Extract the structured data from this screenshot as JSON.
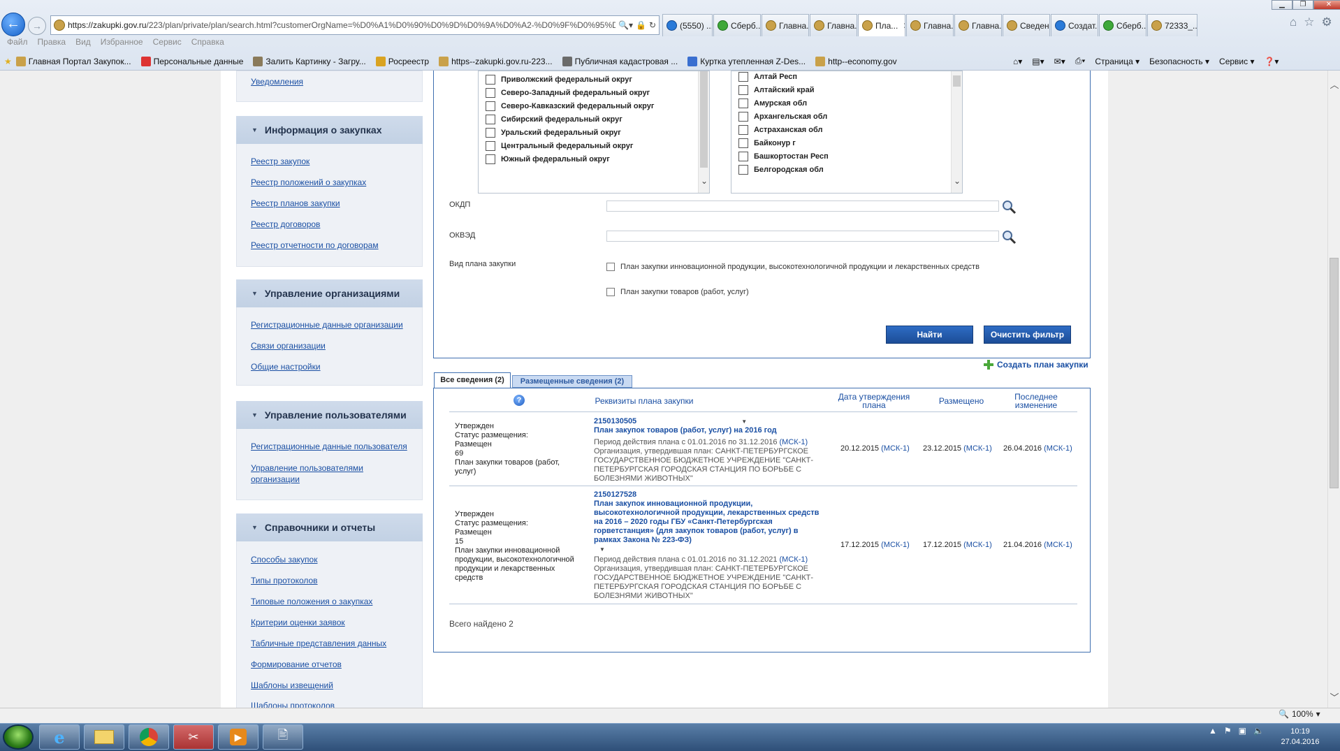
{
  "browser": {
    "url_host": "https://zakupki.gov.ru",
    "url_path": "/223/plan/private/plan/search.html?customerOrgName=%D0%A1%D0%90%D0%9D%D0%9A%D0%A2-%D0%9F%D0%95%D0",
    "tabs": [
      {
        "label": "(5550) ...",
        "icon": "blue"
      },
      {
        "label": "Сберб...",
        "icon": "green"
      },
      {
        "label": "Главна...",
        "icon": "emblem"
      },
      {
        "label": "Главна...",
        "icon": "emblem"
      },
      {
        "label": "Пла...",
        "icon": "emblem",
        "active": true
      },
      {
        "label": "Главна...",
        "icon": "emblem"
      },
      {
        "label": "Главна...",
        "icon": "emblem"
      },
      {
        "label": "Сведен...",
        "icon": "emblem"
      },
      {
        "label": "Создат...",
        "icon": "blue"
      },
      {
        "label": "Сберб...",
        "icon": "green"
      },
      {
        "label": "72333_...",
        "icon": "emblem"
      }
    ],
    "menu": [
      "Файл",
      "Правка",
      "Вид",
      "Избранное",
      "Сервис",
      "Справка"
    ],
    "favorites": [
      "Главная Портал Закупок...",
      "Персональные данные",
      "Залить Картинку - Загру...",
      "Росреестр",
      "https--zakupki.gov.ru-223...",
      "Публичная кадастровая ...",
      "Куртка утепленная Z-Des...",
      "http--economy.gov"
    ],
    "commands": [
      "Страница ▾",
      "Безопасность ▾",
      "Сервис ▾"
    ],
    "zoom": "100%"
  },
  "sidebar": {
    "top_link": "Уведомления",
    "sections": [
      {
        "title": "Информация о закупках",
        "links": [
          "Реестр закупок",
          "Реестр положений о закупках",
          "Реестр планов закупки",
          "Реестр договоров",
          "Реестр отчетности по договорам"
        ]
      },
      {
        "title": "Управление организациями",
        "links": [
          "Регистрационные данные организации",
          "Связи организации",
          "Общие настройки"
        ]
      },
      {
        "title": "Управление пользователями",
        "links": [
          "Регистрационные данные пользователя",
          "Управление пользователями организации"
        ]
      },
      {
        "title": "Справочники и отчеты",
        "links": [
          "Способы закупок",
          "Типы протоколов",
          "Типовые положения о закупках",
          "Критерии оценки заявок",
          "Табличные представления данных",
          "Формирование отчетов",
          "Шаблоны извещений",
          "Шаблоны протоколов"
        ]
      }
    ]
  },
  "filter": {
    "districts": [
      "Приволжский федеральный округ",
      "Северо-Западный федеральный округ",
      "Северо-Кавказский федеральный округ",
      "Сибирский федеральный округ",
      "Уральский федеральный округ",
      "Центральный федеральный округ",
      "Южный федеральный округ"
    ],
    "regions": [
      "Алтай Респ",
      "Алтайский край",
      "Амурская обл",
      "Архангельская обл",
      "Астраханская обл",
      "Байконур г",
      "Башкортостан Респ",
      "Белгородская обл"
    ],
    "okdp_label": "ОКДП",
    "okved_label": "ОКВЭД",
    "plan_type_label": "Вид плана закупки",
    "plan_type_options": [
      "План закупки инновационной продукции, высокотехнологичной продукции и лекарственных средств",
      "План закупки товаров (работ, услуг)"
    ],
    "search_button": "Найти",
    "clear_button": "Очистить фильтр"
  },
  "results": {
    "tab_all": "Все сведения (2)",
    "tab_placed": "Размещенные сведения (2)",
    "create_plan": "Создать план закупки",
    "help_icon": "?",
    "columns": {
      "details": "Реквизиты плана закупки",
      "approval_date_1": "Дата утверждения",
      "approval_date_2": "плана",
      "placed": "Размещено",
      "last_change_1": "Последнее",
      "last_change_2": "изменение"
    },
    "rows": [
      {
        "status": [
          "Утвержден",
          "Статус размещения:",
          "Размещен",
          "69",
          "План закупки товаров (работ,",
          "услуг)"
        ],
        "number": "2150130505",
        "title": [
          "План закупок товаров (работ, услуг) на 2016 год"
        ],
        "period_text": "Период действия плана с 01.01.2016 по 31.12.2016",
        "period_tz": "(МСК-1)",
        "org": [
          "Организация, утвердившая план:  САНКТ-ПЕТЕРБУРГСКОЕ",
          "ГОСУДАРСТВЕННОЕ БЮДЖЕТНОЕ УЧРЕЖДЕНИЕ \"САНКТ-",
          "ПЕТЕРБУРГСКАЯ ГОРОДСКАЯ СТАНЦИЯ ПО БОРЬБЕ С",
          "БОЛЕЗНЯМИ ЖИВОТНЫХ\""
        ],
        "approved": "20.12.2015",
        "placed": "23.12.2015",
        "changed": "26.04.2016",
        "tz": "(МСК-1)"
      },
      {
        "status": [
          "Утвержден",
          "Статус размещения:",
          "Размещен",
          "15",
          "План закупки инновационной",
          "продукции, высокотехнологичной",
          "продукции и лекарственных",
          "средств"
        ],
        "number": "2150127528",
        "title": [
          "План закупок инновационной продукции,",
          "высокотехнологичной продукции, лекарственных средств",
          "на 2016 – 2020 годы ГБУ «Санкт-Петербургская",
          "горветстанция» (для закупок товаров (работ, услуг) в",
          "рамках Закона № 223-ФЗ)"
        ],
        "period_text": "Период действия плана с 01.01.2016 по 31.12.2021",
        "period_tz": "(МСК-1)",
        "org": [
          "Организация, утвердившая план:  САНКТ-ПЕТЕРБУРГСКОЕ",
          "ГОСУДАРСТВЕННОЕ БЮДЖЕТНОЕ УЧРЕЖДЕНИЕ \"САНКТ-",
          "ПЕТЕРБУРГСКАЯ ГОРОДСКАЯ СТАНЦИЯ ПО БОРЬБЕ С",
          "БОЛЕЗНЯМИ ЖИВОТНЫХ\""
        ],
        "approved": "17.12.2015",
        "placed": "17.12.2015",
        "changed": "21.04.2016",
        "tz": "(МСК-1)"
      }
    ],
    "total": "Всего найдено 2"
  },
  "taskbar": {
    "time": "10:19",
    "date": "27.04.2016"
  }
}
